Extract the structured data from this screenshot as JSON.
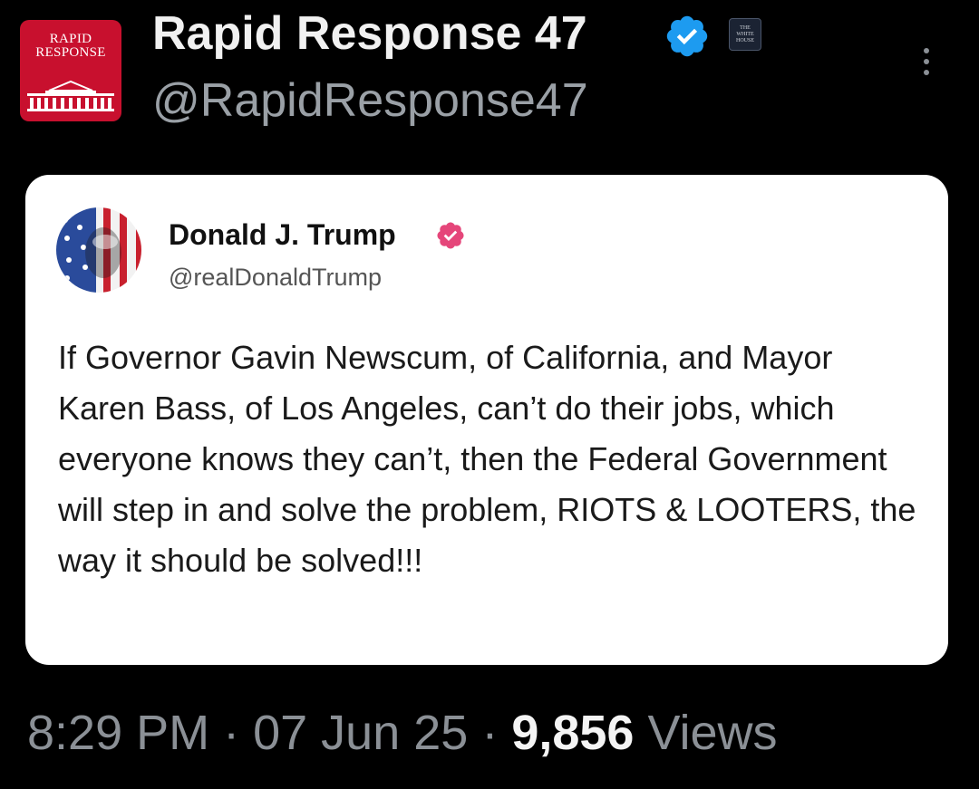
{
  "header": {
    "avatar_text": [
      "RAPID",
      "RESPONSE"
    ],
    "account_name": "Rapid Response 47",
    "handle": "@RapidResponse47",
    "affiliate_badge_text": [
      "THE",
      "WHITE",
      "HOUSE"
    ],
    "verified": true,
    "verified_color": "#1d9bf0"
  },
  "quoted_post": {
    "author_name": "Donald J. Trump",
    "author_handle": "@realDonaldTrump",
    "verified_color": "#e5467a",
    "body": "If Governor Gavin Newscum, of California, and Mayor Karen Bass, of Los Angeles, can’t do their jobs, which everyone knows they can’t, then the Federal Government will step in and solve the problem, RIOTS & LOOTERS, the way it should be solved!!!"
  },
  "meta": {
    "time": "8:29 PM",
    "separator": " · ",
    "date": "07 Jun 25",
    "views_count": "9,856",
    "views_label": "Views"
  },
  "colors": {
    "background": "#000000",
    "brand_red": "#c8102e",
    "card_background": "#ffffff",
    "muted_text": "#8b9096"
  }
}
